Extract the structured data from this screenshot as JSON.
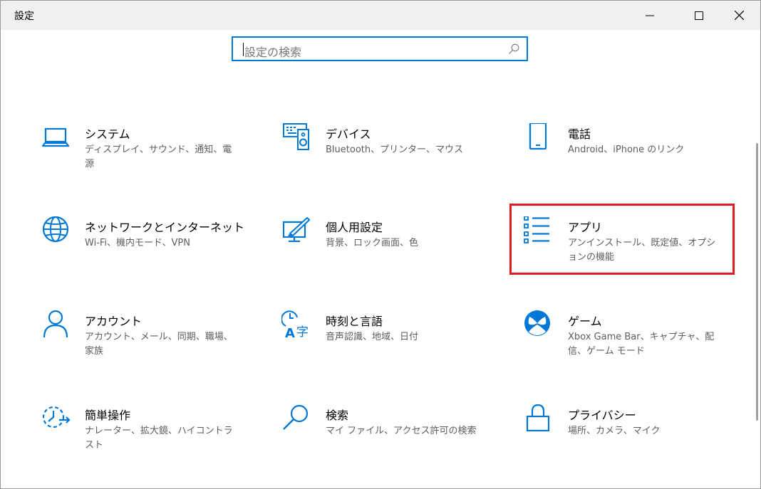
{
  "window": {
    "title": "設定",
    "accent_color": "#0078d7",
    "highlight_color": "#e01b24"
  },
  "search": {
    "placeholder": "設定の検索",
    "icon": "search-icon"
  },
  "categories": [
    {
      "label": "システム",
      "desc": "ディスプレイ、サウンド、通知、電源",
      "icon": "laptop-icon"
    },
    {
      "label": "デバイス",
      "desc": "Bluetooth、プリンター、マウス",
      "icon": "devices-icon"
    },
    {
      "label": "電話",
      "desc": "Android、iPhone のリンク",
      "icon": "phone-icon"
    },
    {
      "label": "ネットワークとインターネット",
      "desc": "Wi-Fi、機内モード、VPN",
      "icon": "globe-icon"
    },
    {
      "label": "個人用設定",
      "desc": "背景、ロック画面、色",
      "icon": "personalization-icon"
    },
    {
      "label": "アプリ",
      "desc": "アンインストール、既定値、オプションの機能",
      "icon": "apps-list-icon",
      "highlighted": true
    },
    {
      "label": "アカウント",
      "desc": "アカウント、メール、同期、職場、家族",
      "icon": "person-icon"
    },
    {
      "label": "時刻と言語",
      "desc": "音声認識、地域、日付",
      "icon": "time-language-icon"
    },
    {
      "label": "ゲーム",
      "desc": "Xbox Game Bar、キャプチャ、配信、ゲーム モード",
      "icon": "xbox-icon"
    },
    {
      "label": "簡単操作",
      "desc": "ナレーター、拡大鏡、ハイコントラスト",
      "icon": "ease-of-access-icon"
    },
    {
      "label": "検索",
      "desc": "マイ ファイル、アクセス許可の検索",
      "icon": "magnifier-icon"
    },
    {
      "label": "プライバシー",
      "desc": "場所、カメラ、マイク",
      "icon": "lock-icon"
    }
  ]
}
